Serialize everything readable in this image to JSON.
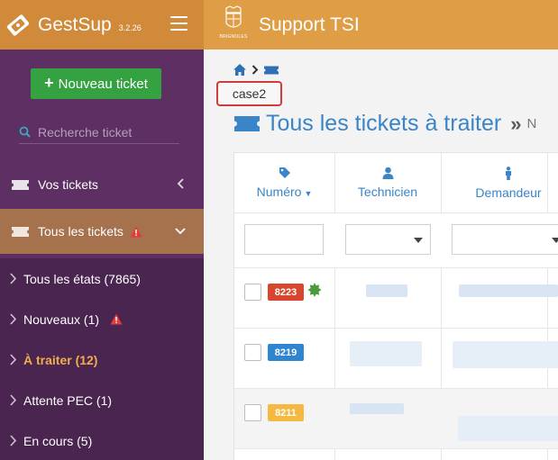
{
  "app": {
    "name": "GestSup",
    "version": "3.2.26"
  },
  "topbar": {
    "title": "Support TSI",
    "crest_text": "BRIGNOLES"
  },
  "sidebar": {
    "new_ticket_label": "Nouveau ticket",
    "search_placeholder": "Recherche ticket",
    "items": [
      {
        "label": "Vos tickets"
      },
      {
        "label": "Tous les tickets"
      }
    ],
    "subitems": [
      {
        "label": "Tous les états (7865)"
      },
      {
        "label": "Nouveaux (1)"
      },
      {
        "label": "À traiter (12)"
      },
      {
        "label": "Attente PEC (1)"
      },
      {
        "label": "En cours (5)"
      }
    ]
  },
  "main": {
    "breadcrumb_case": "case2",
    "heading": "Tous les tickets à traiter",
    "heading_sep": "»",
    "heading_more": "N"
  },
  "table": {
    "columns": [
      {
        "label": "Numéro",
        "sort": "▼"
      },
      {
        "label": "Technicien"
      },
      {
        "label": "Demandeur"
      }
    ],
    "rows": [
      {
        "number": "8223",
        "color": "#d9462f"
      },
      {
        "number": "8219",
        "color": "#2f86d0"
      },
      {
        "number": "8211",
        "color": "#f5b942"
      }
    ]
  },
  "colors": {
    "brand": "#d08a3a",
    "topbar": "#df9d45",
    "sidebar": "#5d2f63",
    "accent": "#3a84c8",
    "success": "#34a240"
  }
}
